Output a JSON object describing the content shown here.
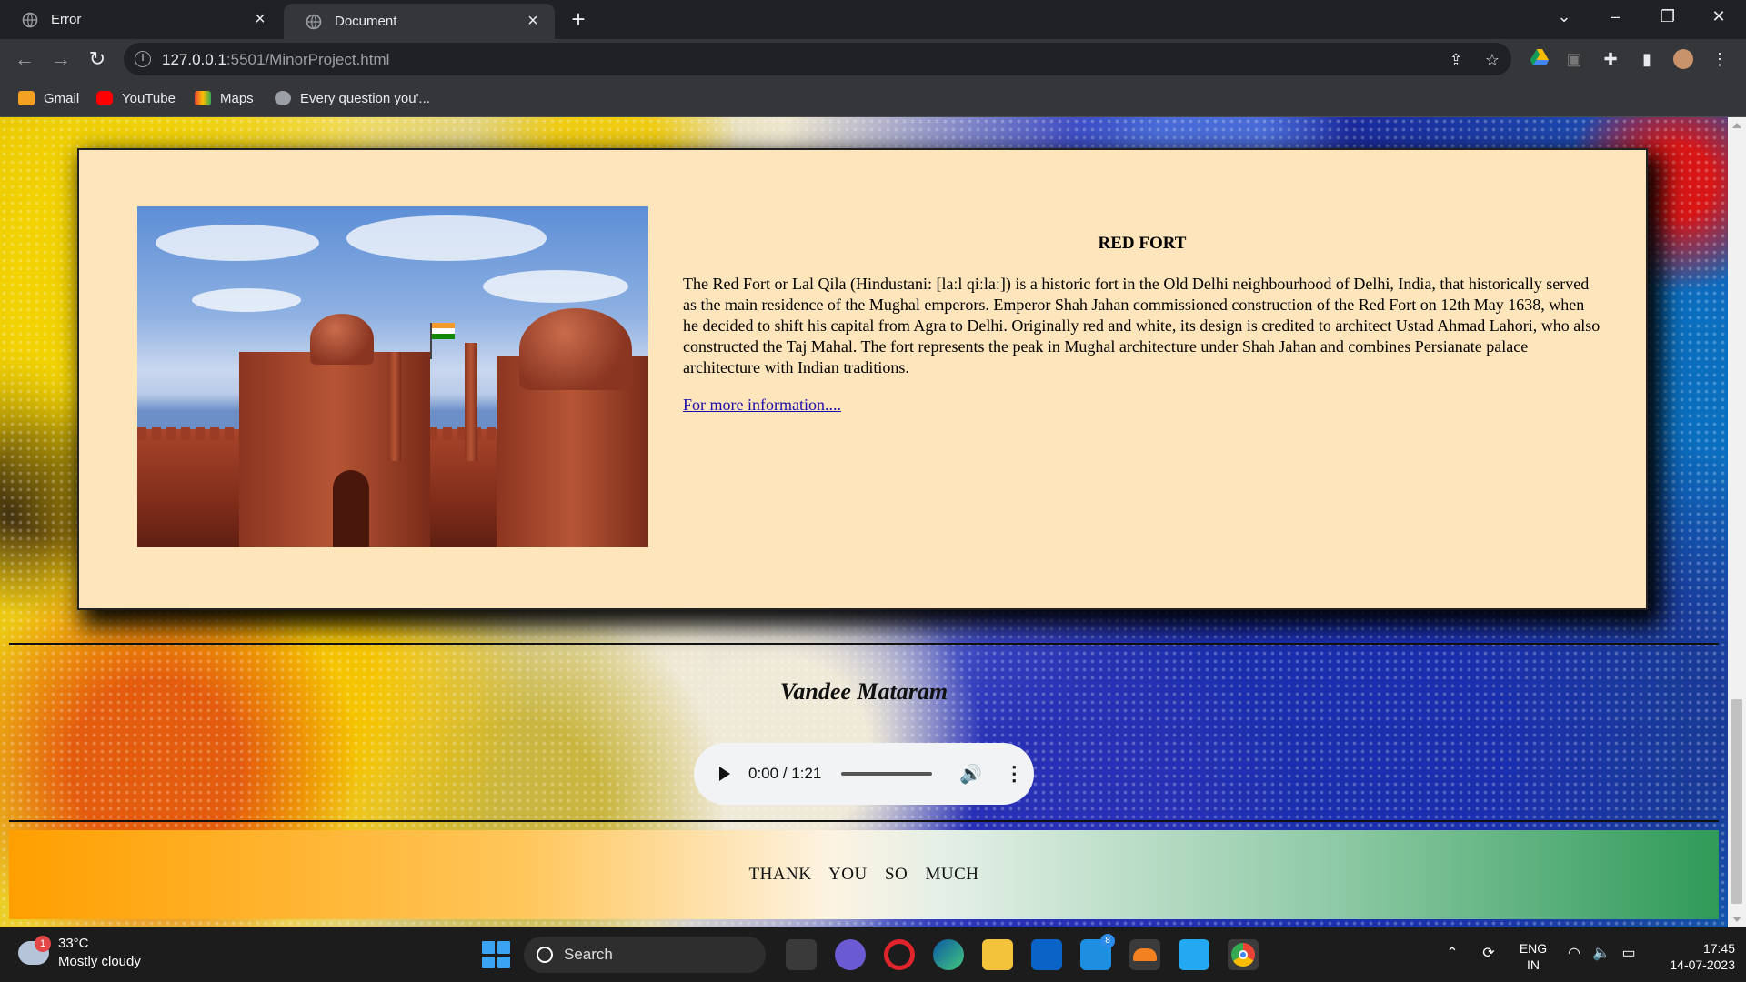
{
  "browser": {
    "tabs": [
      {
        "title": "Error",
        "active": false
      },
      {
        "title": "Document",
        "active": true
      }
    ],
    "url_host": "127.0.0.1",
    "url_rest": ":5501/MinorProject.html",
    "bookmarks": [
      {
        "label": "Gmail",
        "color": "#f4a020"
      },
      {
        "label": "YouTube",
        "color": "#ff0000"
      },
      {
        "label": "Maps",
        "color": "#ea4335"
      },
      {
        "label": "Every question you'...",
        "color": "#9aa0a6"
      }
    ]
  },
  "page": {
    "heading": "RED FORT",
    "description": "The Red Fort or Lal Qila (Hindustani: [laːl qiːlaː]) is a historic fort in the Old Delhi neighbourhood of Delhi, India, that historically served as the main residence of the Mughal emperors. Emperor Shah Jahan commissioned construction of the Red Fort on 12th May 1638, when he decided to shift his capital from Agra to Delhi. Originally red and white, its design is credited to architect Ustad Ahmad Lahori, who also constructed the Taj Mahal. The fort represents the peak in Mughal architecture under Shah Jahan and combines Persianate palace architecture with Indian traditions.",
    "link_text": "For more information....",
    "motto": "Vandee Mataram",
    "audio": {
      "current": "0:00",
      "duration": "1:21",
      "time_display": "0:00 / 1:21"
    },
    "footer_text": "THANK YOU SO MUCH"
  },
  "taskbar": {
    "weather_temp": "33°C",
    "weather_desc": "Mostly cloudy",
    "weather_badge": "1",
    "search_label": "Search",
    "lang_top": "ENG",
    "lang_bottom": "IN",
    "time": "17:45",
    "date": "14-07-2023",
    "mail_badge": "8"
  }
}
